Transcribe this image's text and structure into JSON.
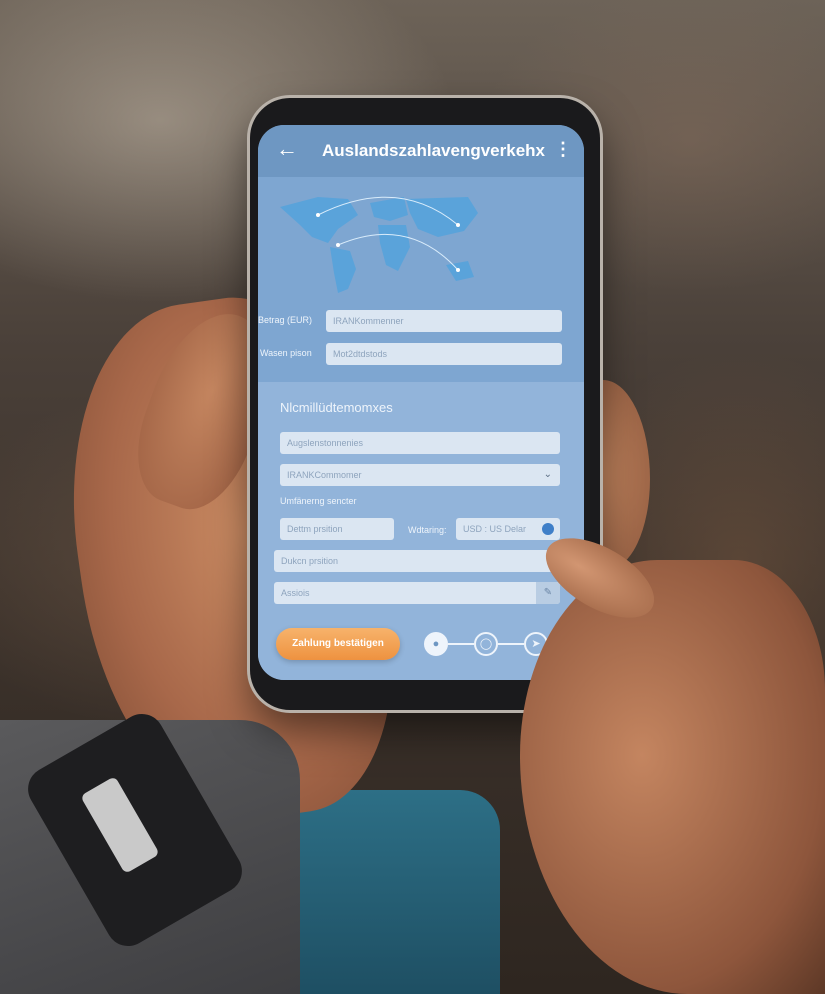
{
  "appbar": {
    "title": "Auslandszahlavengverkehx",
    "back_icon": "arrow-left-icon",
    "menu_icon": "more-vert-icon"
  },
  "upper_form": {
    "amount_label": "Betrag (EUR)",
    "amount_value": "IRANKommenner",
    "recipient_label": "Wasen pison",
    "recipient_value": "Mot2dtdstods"
  },
  "lower_form": {
    "section_title": "Nlcmillüdtemomxes",
    "field1_value": "Augslenstonnenies",
    "select_value": "IRANKCommomer",
    "sub_label": "Umfänerng sencter",
    "field3_value": "Dettm prsition",
    "currency_label": "Wdtaring:",
    "currency_value": "USD : US Delar",
    "field4_value": "Dukcn prsition",
    "field5_value": "Assiois"
  },
  "actions": {
    "confirm_label": "Zahlung bestätigen"
  },
  "steps": {
    "icons": [
      "lock-icon",
      "chat-icon",
      "send-icon"
    ],
    "active_index": 0
  },
  "colors": {
    "appbar": "#6e97c2",
    "screen_bg": "#7fa6cf",
    "panel_bg": "#92b4da",
    "accent_button": "#f0a050"
  }
}
